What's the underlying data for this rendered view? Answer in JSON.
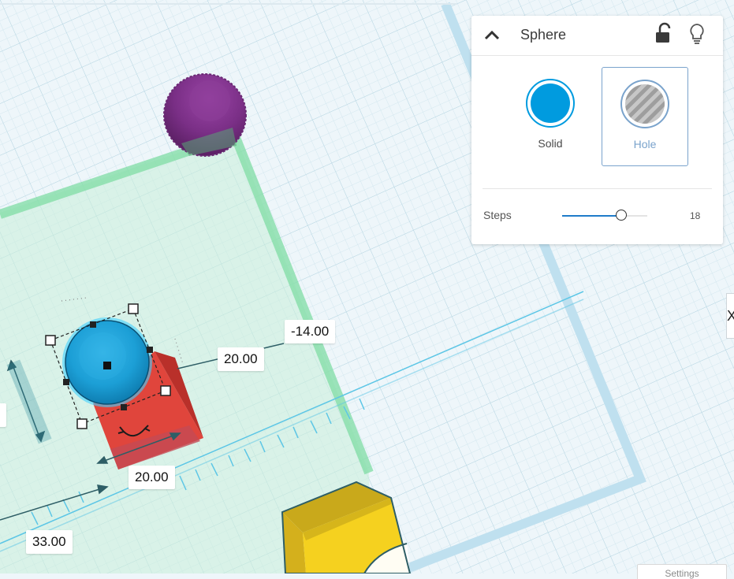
{
  "inspector": {
    "title": "Sphere",
    "icons": {
      "collapse": "chevron-up-icon",
      "lock": "unlock-icon",
      "visibility": "lightbulb-icon"
    },
    "solid_label": "Solid",
    "hole_label": "Hole",
    "solid_color": "#009bdf",
    "steps_label": "Steps",
    "steps_value": "18",
    "steps_fraction": 0.69
  },
  "dimensions": {
    "elevation": "-14.00",
    "length": "20.00",
    "width": "20.00",
    "position": "33.00"
  },
  "side_tab_glyph": "X",
  "settings_label": "Settings",
  "colors": {
    "workplane_bg": "#eef6fa",
    "grid_line": "#cfe4ec",
    "selection_outline": "#39c27a",
    "sphere_selected": "#1c9fd6",
    "box_red": "#e0453c",
    "sphere_purple": "#7a2f86",
    "box_yellow": "#f5d11f"
  }
}
